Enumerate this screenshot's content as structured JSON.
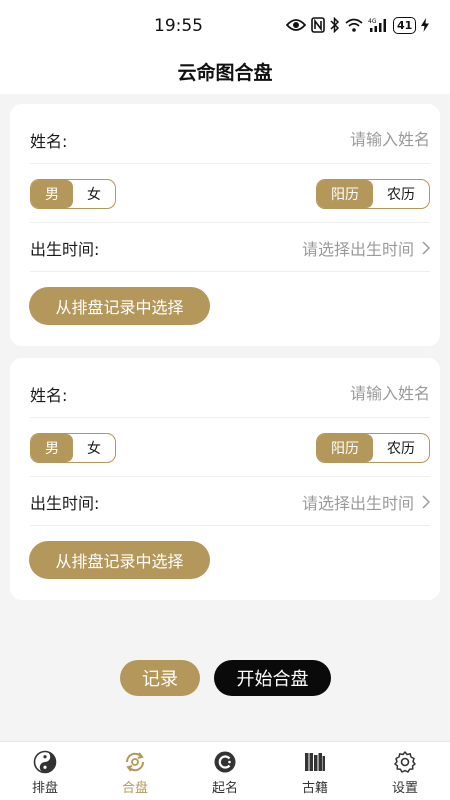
{
  "status_bar": {
    "time": "19:55",
    "battery": "41"
  },
  "header": {
    "title": "云命图合盘"
  },
  "people": [
    {
      "name_label": "姓名:",
      "name_placeholder": "请输入姓名",
      "gender_options": [
        "男",
        "女"
      ],
      "gender_selected": "男",
      "calendar_options": [
        "阳历",
        "农历"
      ],
      "calendar_selected": "阳历",
      "birth_label": "出生时间:",
      "birth_placeholder": "请选择出生时间",
      "select_button": "从排盘记录中选择"
    },
    {
      "name_label": "姓名:",
      "name_placeholder": "请输入姓名",
      "gender_options": [
        "男",
        "女"
      ],
      "gender_selected": "男",
      "calendar_options": [
        "阳历",
        "农历"
      ],
      "calendar_selected": "阳历",
      "birth_label": "出生时间:",
      "birth_placeholder": "请选择出生时间",
      "select_button": "从排盘记录中选择"
    }
  ],
  "actions": {
    "record": "记录",
    "start": "开始合盘"
  },
  "tabbar": {
    "active": "合盘",
    "items": [
      {
        "label": "排盘",
        "icon": "yin-yang-icon"
      },
      {
        "label": "合盘",
        "icon": "merge-chart-icon"
      },
      {
        "label": "起名",
        "icon": "naming-icon"
      },
      {
        "label": "古籍",
        "icon": "books-icon"
      },
      {
        "label": "设置",
        "icon": "gear-icon"
      }
    ]
  },
  "colors": {
    "accent": "#b4975a",
    "dark_button": "#0a0a0a",
    "background": "#f4f4f4"
  }
}
